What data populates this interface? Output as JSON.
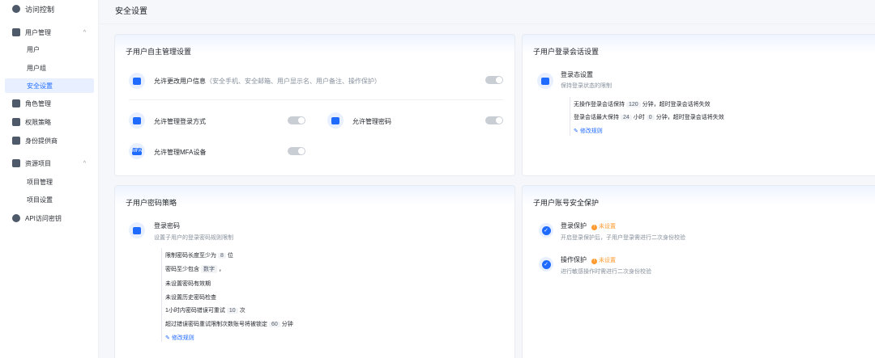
{
  "sidebar": {
    "access_control": "访问控制",
    "user_mgmt": "用户管理",
    "users": "用户",
    "user_groups": "用户组",
    "security_settings": "安全设置",
    "role_mgmt": "角色管理",
    "policies": "权限策略",
    "idp": "身份提供商",
    "resource_projects": "资源项目",
    "project_mgmt": "项目管理",
    "project_settings": "项目设置",
    "api_keys": "API访问密钥"
  },
  "header": {
    "title": "安全设置"
  },
  "self_mgmt": {
    "title": "子用户自主管理设置",
    "edit_info": "允许更改用户信息",
    "edit_info_hint": "（安全手机、安全邮箱、用户显示名、用户备注、操作保护）",
    "login_method": "允许管理登录方式",
    "password": "允许管理密码",
    "mfa": "允许管理MFA设备",
    "mfa_icon_text": "MFA"
  },
  "session": {
    "title": "子用户登录会话设置",
    "name": "登录态设置",
    "desc": "保持登录状态的限制",
    "line1_a": "无操作登录会话保持",
    "line1_val": "120",
    "line1_b": "分钟，超时登录会话将失效",
    "line2_a": "登录会话最大保持",
    "line2_h": "24",
    "line2_b": "小时",
    "line2_m": "0",
    "line2_c": "分钟，超时登录会话将失效",
    "edit": "修改规则"
  },
  "pwd_policy": {
    "title": "子用户密码策略",
    "name": "登录密码",
    "desc": "设置子用户的登录密码规则限制",
    "min_len_a": "限制密码长度至少为",
    "min_len_val": "8",
    "min_len_b": "位",
    "contain_a": "密码至少包含",
    "contain_val": "数字",
    "contain_b": "，",
    "no_expiry": "未设置密码有效期",
    "no_history": "未设置历史密码检查",
    "retry_a": "1小时内密码错误可重试",
    "retry_val": "10",
    "retry_b": "次",
    "lock_a": "超过错误密码重试限制次数账号将被锁定",
    "lock_val": "60",
    "lock_b": "分钟",
    "edit": "修改规则"
  },
  "account_protect": {
    "title": "子用户账号安全保护",
    "login_protect": "登录保护",
    "login_status": "未设置",
    "login_desc": "开启登录保护后，子用户登录需进行二次身份校验",
    "op_protect": "操作保护",
    "op_status": "未设置",
    "op_desc": "进行敏感操作时需进行二次身份校验"
  },
  "colors": {
    "accent": "#1f6bff",
    "warning": "#ff9a2e",
    "toggle_off": "#c9cdd4"
  }
}
